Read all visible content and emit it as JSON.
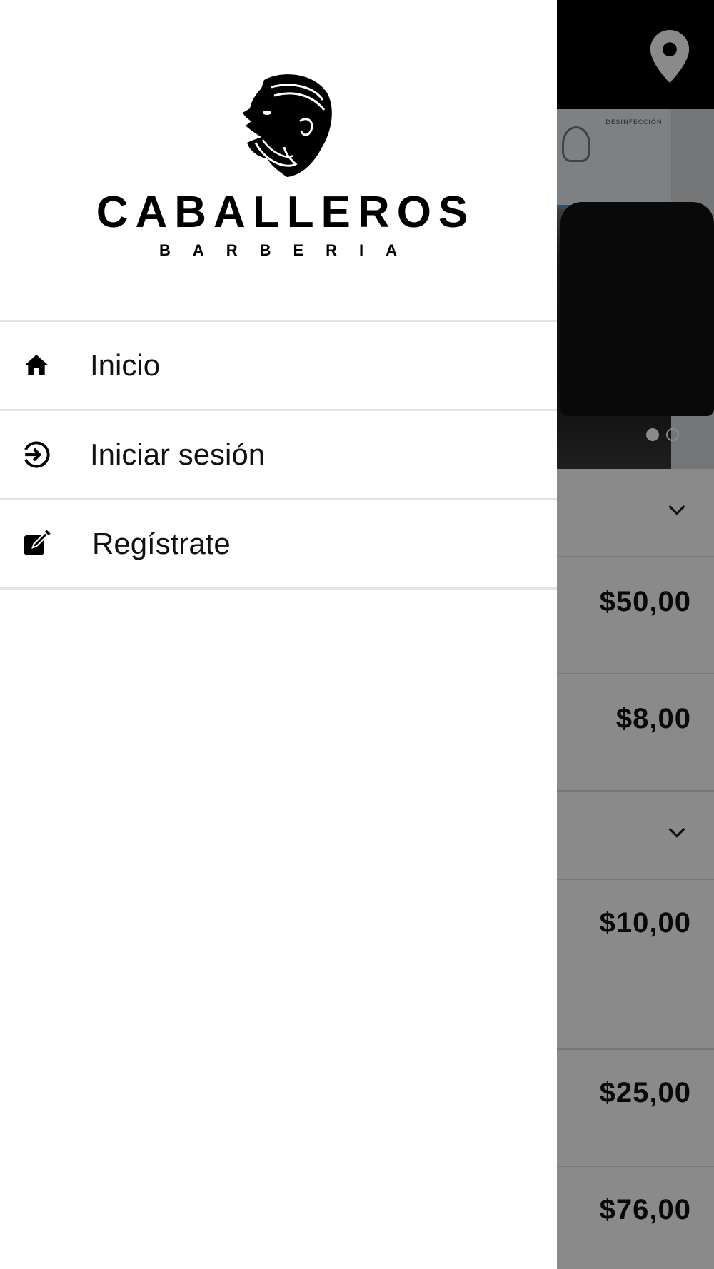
{
  "brand": {
    "name": "CABALLEROS",
    "subtitle": "BARBERIA"
  },
  "drawer": {
    "items": [
      {
        "label": "Inicio",
        "icon": "home-icon"
      },
      {
        "label": "Iniciar sesión",
        "icon": "login-icon"
      },
      {
        "label": "Regístrate",
        "icon": "edit-icon"
      }
    ]
  },
  "background": {
    "carousel_pages": 2,
    "carousel_active": 1,
    "poster_text": "DESINFECCIÓN",
    "prices": [
      "$50,00",
      "$8,00",
      "$10,00",
      "$25,00",
      "$76,00"
    ]
  },
  "colors": {
    "topbar": "#000000",
    "scrim": "rgba(0,0,0,0.46)",
    "divider": "#e3e3e3"
  }
}
